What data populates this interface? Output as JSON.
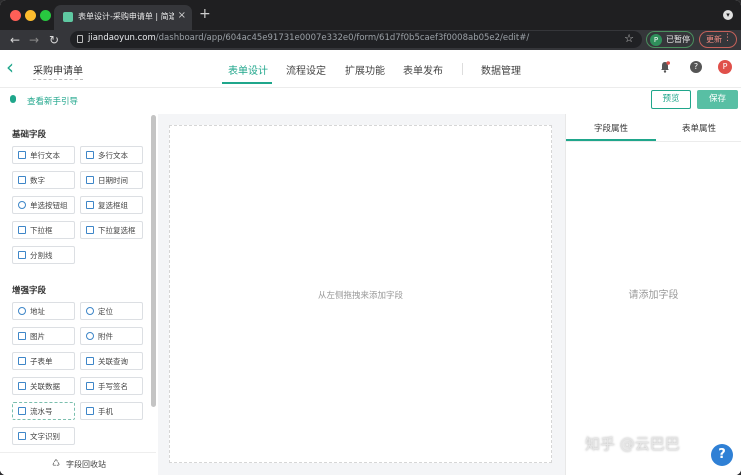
{
  "browser": {
    "tab_title": "表单设计-采购申请单 | 简道云",
    "tab_close": "×",
    "newtab": "+",
    "url_domain": "jiandaoyun.com",
    "url_path": "/dashboard/app/604ac45e91731e0007e332e0/form/61d7f0b5caef3f0008ab05e2/edit#/",
    "profile_initial": "P",
    "profile_label": "已暂停",
    "update_label": "更新",
    "update_dots": "⋮"
  },
  "header": {
    "form_name": "采购申请单",
    "tabs": [
      {
        "label": "表单设计",
        "active": true
      },
      {
        "label": "流程设定"
      },
      {
        "label": "扩展功能"
      },
      {
        "label": "表单发布"
      },
      {
        "label": "数据管理"
      }
    ],
    "help_icon": "?",
    "avatar_initial": "P"
  },
  "subbar": {
    "guide_label": "查看新手引导",
    "preview_label": "预览",
    "save_label": "保存"
  },
  "left_panel": {
    "basic_title": "基础字段",
    "basic_fields": [
      {
        "label": "单行文本",
        "icon": "single-line-text-icon"
      },
      {
        "label": "多行文本",
        "icon": "multi-line-text-icon"
      },
      {
        "label": "数字",
        "icon": "number-icon"
      },
      {
        "label": "日期时间",
        "icon": "datetime-icon"
      },
      {
        "label": "单选按钮组",
        "icon": "radio-icon"
      },
      {
        "label": "复选框组",
        "icon": "checkbox-icon"
      },
      {
        "label": "下拉框",
        "icon": "dropdown-icon"
      },
      {
        "label": "下拉复选框",
        "icon": "dropdown-checkbox-icon"
      },
      {
        "label": "分割线",
        "icon": "divider-icon"
      }
    ],
    "advanced_title": "增强字段",
    "advanced_fields": [
      {
        "label": "地址",
        "icon": "address-icon"
      },
      {
        "label": "定位",
        "icon": "location-icon"
      },
      {
        "label": "图片",
        "icon": "image-icon"
      },
      {
        "label": "附件",
        "icon": "attachment-icon"
      },
      {
        "label": "子表单",
        "icon": "subform-icon"
      },
      {
        "label": "关联查询",
        "icon": "linked-query-icon"
      },
      {
        "label": "关联数据",
        "icon": "linked-data-icon"
      },
      {
        "label": "手写签名",
        "icon": "signature-icon"
      },
      {
        "label": "流水号",
        "icon": "serial-number-icon"
      },
      {
        "label": "手机",
        "icon": "phone-icon"
      },
      {
        "label": "文字识别",
        "icon": "ocr-icon"
      }
    ],
    "recycle_label": "字段回收站"
  },
  "canvas": {
    "hint": "从左侧拖拽来添加字段"
  },
  "right_panel": {
    "tab_field": "字段属性",
    "tab_form": "表单属性",
    "empty_hint": "请添加字段"
  },
  "watermark": "知乎 @云巴巴",
  "float_help": "?",
  "colors": {
    "accent": "#1fa68b",
    "save_button": "#58bfa4",
    "icon_blue": "#3e86c8"
  }
}
